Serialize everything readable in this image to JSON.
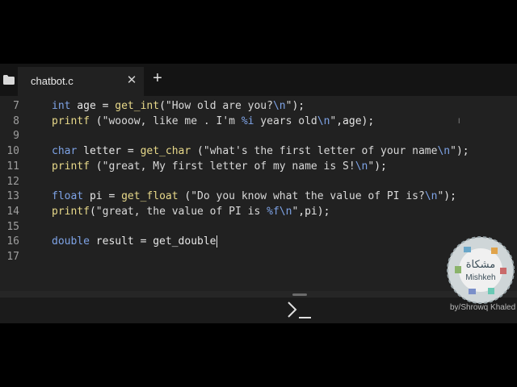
{
  "tab": {
    "filename": "chatbot.c",
    "close_glyph": "✕",
    "add_glyph": "+"
  },
  "icons": {
    "folder": "folder-icon",
    "close": "close-icon",
    "add": "plus-icon",
    "terminal": "terminal-prompt-icon"
  },
  "lines": [
    {
      "num": "7",
      "segments": [
        {
          "t": "int",
          "c": "kw"
        },
        {
          "t": " age = ",
          "c": ""
        },
        {
          "t": "get_int",
          "c": "fn"
        },
        {
          "t": "(",
          "c": ""
        },
        {
          "t": "\"How old are you?",
          "c": "str"
        },
        {
          "t": "\\n",
          "c": "esc"
        },
        {
          "t": "\"",
          "c": "str"
        },
        {
          "t": ");",
          "c": ""
        }
      ]
    },
    {
      "num": "8",
      "segments": [
        {
          "t": "printf",
          "c": "fn"
        },
        {
          "t": " (",
          "c": ""
        },
        {
          "t": "\"wooow, like me . I'm ",
          "c": "str"
        },
        {
          "t": "%i",
          "c": "esc"
        },
        {
          "t": " years old",
          "c": "str"
        },
        {
          "t": "\\n",
          "c": "esc"
        },
        {
          "t": "\"",
          "c": "str"
        },
        {
          "t": ",age);",
          "c": ""
        }
      ]
    },
    {
      "num": "9",
      "segments": []
    },
    {
      "num": "10",
      "segments": [
        {
          "t": "char",
          "c": "kw"
        },
        {
          "t": " letter = ",
          "c": ""
        },
        {
          "t": "get_char",
          "c": "fn"
        },
        {
          "t": " (",
          "c": ""
        },
        {
          "t": "\"what's the first letter of your name",
          "c": "str"
        },
        {
          "t": "\\n",
          "c": "esc"
        },
        {
          "t": "\"",
          "c": "str"
        },
        {
          "t": ");",
          "c": ""
        }
      ]
    },
    {
      "num": "11",
      "segments": [
        {
          "t": "printf",
          "c": "fn"
        },
        {
          "t": " (",
          "c": ""
        },
        {
          "t": "\"great, My first letter of my name is S!",
          "c": "str"
        },
        {
          "t": "\\n",
          "c": "esc"
        },
        {
          "t": "\"",
          "c": "str"
        },
        {
          "t": ");",
          "c": ""
        }
      ]
    },
    {
      "num": "12",
      "segments": []
    },
    {
      "num": "13",
      "segments": [
        {
          "t": "float",
          "c": "kw"
        },
        {
          "t": " pi = ",
          "c": ""
        },
        {
          "t": "get_float",
          "c": "fn"
        },
        {
          "t": " (",
          "c": ""
        },
        {
          "t": "\"Do you know what the value of PI is?",
          "c": "str"
        },
        {
          "t": "\\n",
          "c": "esc"
        },
        {
          "t": "\"",
          "c": "str"
        },
        {
          "t": ");",
          "c": ""
        }
      ]
    },
    {
      "num": "14",
      "segments": [
        {
          "t": "printf",
          "c": "fn"
        },
        {
          "t": "(",
          "c": ""
        },
        {
          "t": "\"great, the value of PI is ",
          "c": "str"
        },
        {
          "t": "%f",
          "c": "esc"
        },
        {
          "t": "\\n",
          "c": "esc"
        },
        {
          "t": "\"",
          "c": "str"
        },
        {
          "t": ",pi);",
          "c": ""
        }
      ]
    },
    {
      "num": "15",
      "segments": []
    },
    {
      "num": "16",
      "segments": [
        {
          "t": "double",
          "c": "kw"
        },
        {
          "t": " result = get_double",
          "c": ""
        }
      ],
      "caret": true
    },
    {
      "num": "17",
      "segments": []
    }
  ],
  "terminal": {
    "prompt": "terminal-prompt-icon"
  },
  "logo": {
    "name": "Mishkeh",
    "arabic": "مشكاة"
  },
  "credit": "by/Shrowq Khaled",
  "colors": {
    "background": "#212121",
    "keyword": "#7ea3e6",
    "function": "#e8d98a",
    "text": "#e6e6e6"
  }
}
